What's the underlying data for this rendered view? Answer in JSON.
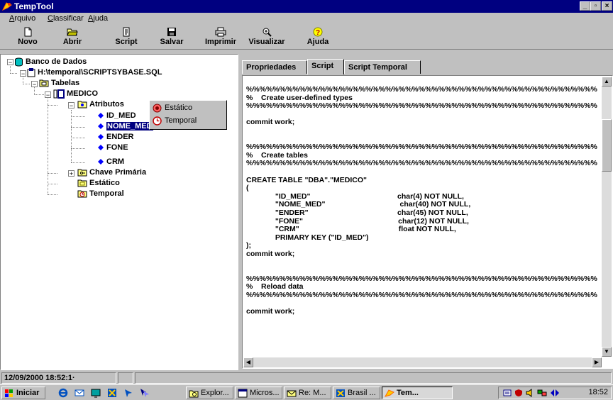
{
  "window": {
    "title": "TempTool"
  },
  "controls": {
    "minimize": "_",
    "maximize": "▫",
    "close": "×"
  },
  "menu": [
    {
      "label": "Arquivo"
    },
    {
      "label": "Classificar"
    },
    {
      "label": "Ajuda"
    }
  ],
  "toolbar": {
    "novo": "Novo",
    "abrir": "Abrir",
    "script": "Script",
    "salvar": "Salvar",
    "imprimir": "Imprimir",
    "visualizar": "Visualizar",
    "ajuda": "Ajuda"
  },
  "tree": {
    "root": "Banco de Dados",
    "file": "H:\\temporal\\SCRIPTSYBASE.SQL",
    "tabelas": "Tabelas",
    "medico": "MEDICO",
    "atributos": "Atributos",
    "attrs": [
      "ID_MED",
      "NOME_MED",
      "ENDER",
      "FONE",
      "CRM"
    ],
    "chave": "Chave Primária",
    "estatico": "Estático",
    "temporal": "Temporal"
  },
  "context_menu": [
    {
      "label": "Estático"
    },
    {
      "label": "Temporal"
    }
  ],
  "tabs": [
    {
      "label": "Propriedades"
    },
    {
      "label": "Script"
    },
    {
      "label": "Script Temporal"
    }
  ],
  "script_text": "%%%%%%%%%%%%%%%%%%%%%%%%%%%%%%%%%%%%%%%%%%%%%%%%%%%%%%%%%%%%%%%\n%    Create user-defined types\n%%%%%%%%%%%%%%%%%%%%%%%%%%%%%%%%%%%%%%%%%%%%%%%%%%%%%%%%%%%%%%%\n\ncommit work;\n\n\n%%%%%%%%%%%%%%%%%%%%%%%%%%%%%%%%%%%%%%%%%%%%%%%%%%%%%%%%%%%%%%%\n%    Create tables\n%%%%%%%%%%%%%%%%%%%%%%%%%%%%%%%%%%%%%%%%%%%%%%%%%%%%%%%%%%%%%%%\n\nCREATE TABLE \"DBA\".\"MEDICO\"\n(\n              \"ID_MED\"                                          char(4) NOT NULL,\n              \"NOME_MED\"                                    char(40) NOT NULL,\n              \"ENDER\"                                           char(45) NOT NULL,\n              \"FONE\"                                              char(12) NOT NULL,\n              \"CRM\"                                                float NOT NULL,\n              PRIMARY KEY (\"ID_MED\")\n);\ncommit work;\n\n\n%%%%%%%%%%%%%%%%%%%%%%%%%%%%%%%%%%%%%%%%%%%%%%%%%%%%%%%%%%%%%%%\n%    Reload data\n%%%%%%%%%%%%%%%%%%%%%%%%%%%%%%%%%%%%%%%%%%%%%%%%%%%%%%%%%%%%%%%\n\ncommit work;",
  "status": {
    "datetime": "12/09/2000 18:52:1·"
  },
  "taskbar": {
    "start": "Iniciar",
    "tasks": [
      {
        "label": "Explor..."
      },
      {
        "label": "Micros..."
      },
      {
        "label": "Re: M..."
      },
      {
        "label": "Brasil ..."
      },
      {
        "label": "Tem..."
      }
    ],
    "clock": "18:52"
  },
  "colors": {
    "titlebar": "#000080",
    "selection": "#000080",
    "face": "#c0c0c0"
  }
}
